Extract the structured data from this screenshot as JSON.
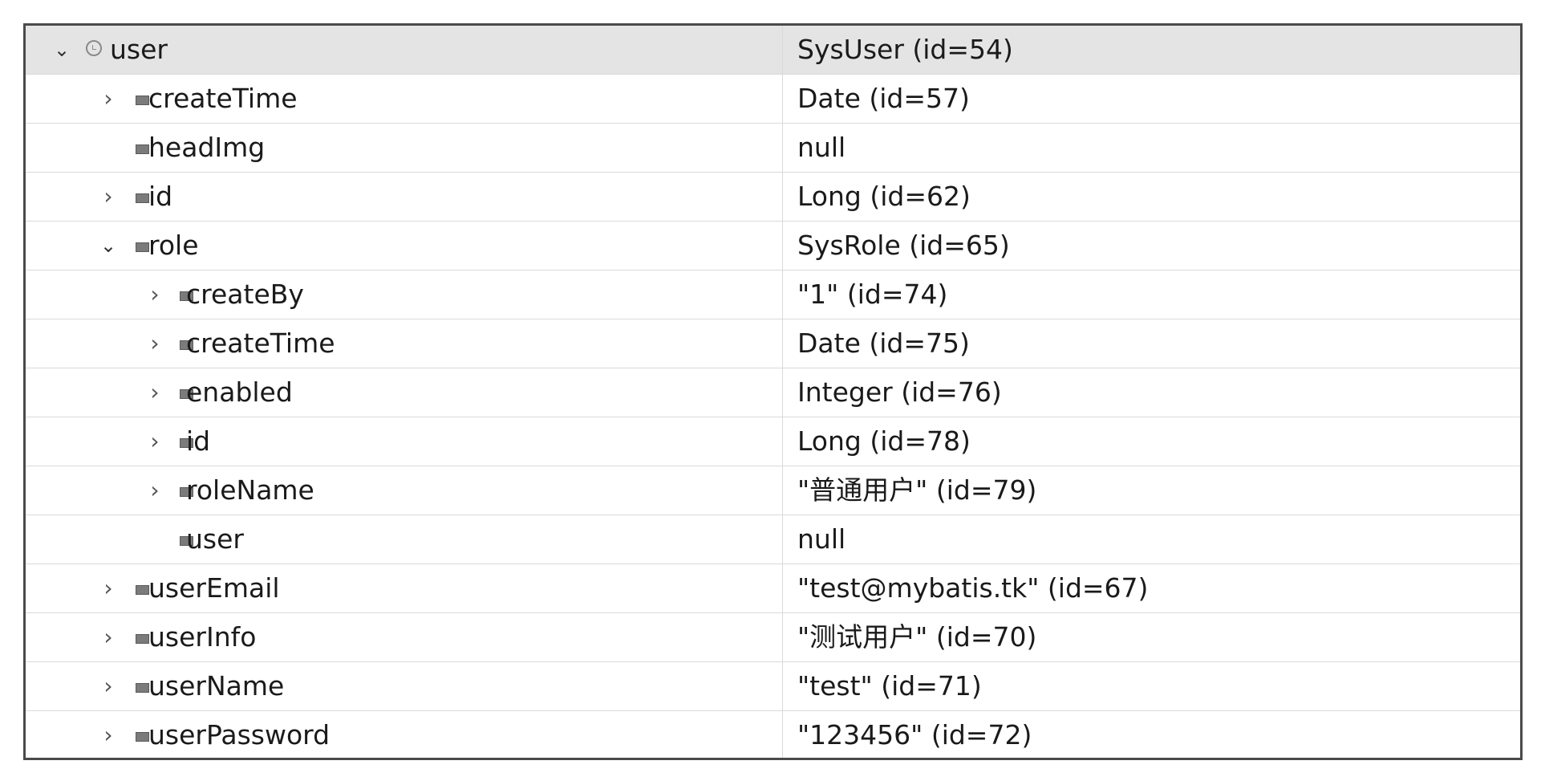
{
  "variables": [
    {
      "level": 0,
      "toggle": "expanded",
      "icon": "local",
      "name": "user",
      "value": "SysUser  (id=54)",
      "selected": true
    },
    {
      "level": 1,
      "toggle": "collapsed",
      "icon": "field",
      "name": "createTime",
      "value": "Date  (id=57)"
    },
    {
      "level": 1,
      "toggle": "none",
      "icon": "field",
      "name": "headImg",
      "value": "null"
    },
    {
      "level": 1,
      "toggle": "collapsed",
      "icon": "field",
      "name": "id",
      "value": "Long  (id=62)"
    },
    {
      "level": 1,
      "toggle": "expanded",
      "icon": "field",
      "name": "role",
      "value": "SysRole  (id=65)"
    },
    {
      "level": 2,
      "toggle": "collapsed",
      "icon": "field",
      "name": "createBy",
      "value": "\"1\" (id=74)"
    },
    {
      "level": 2,
      "toggle": "collapsed",
      "icon": "field",
      "name": "createTime",
      "value": "Date  (id=75)"
    },
    {
      "level": 2,
      "toggle": "collapsed",
      "icon": "field",
      "name": "enabled",
      "value": "Integer  (id=76)"
    },
    {
      "level": 2,
      "toggle": "collapsed",
      "icon": "field",
      "name": "id",
      "value": "Long  (id=78)"
    },
    {
      "level": 2,
      "toggle": "collapsed",
      "icon": "field",
      "name": "roleName",
      "value": "\"普通用户\" (id=79)"
    },
    {
      "level": 2,
      "toggle": "none",
      "icon": "field",
      "name": "user",
      "value": "null"
    },
    {
      "level": 1,
      "toggle": "collapsed",
      "icon": "field",
      "name": "userEmail",
      "value": "\"test@mybatis.tk\" (id=67)"
    },
    {
      "level": 1,
      "toggle": "collapsed",
      "icon": "field",
      "name": "userInfo",
      "value": "\"测试用户\" (id=70)"
    },
    {
      "level": 1,
      "toggle": "collapsed",
      "icon": "field",
      "name": "userName",
      "value": "\"test\" (id=71)"
    },
    {
      "level": 1,
      "toggle": "collapsed",
      "icon": "field",
      "name": "userPassword",
      "value": "\"123456\" (id=72)"
    }
  ],
  "glyphs": {
    "expanded": "⌄",
    "collapsed": "›"
  },
  "colors": {
    "selected_row": "#e4e4e4",
    "grid_line": "#dadada",
    "border": "#4a4a4a",
    "field_icon": "#7b7b7b"
  }
}
